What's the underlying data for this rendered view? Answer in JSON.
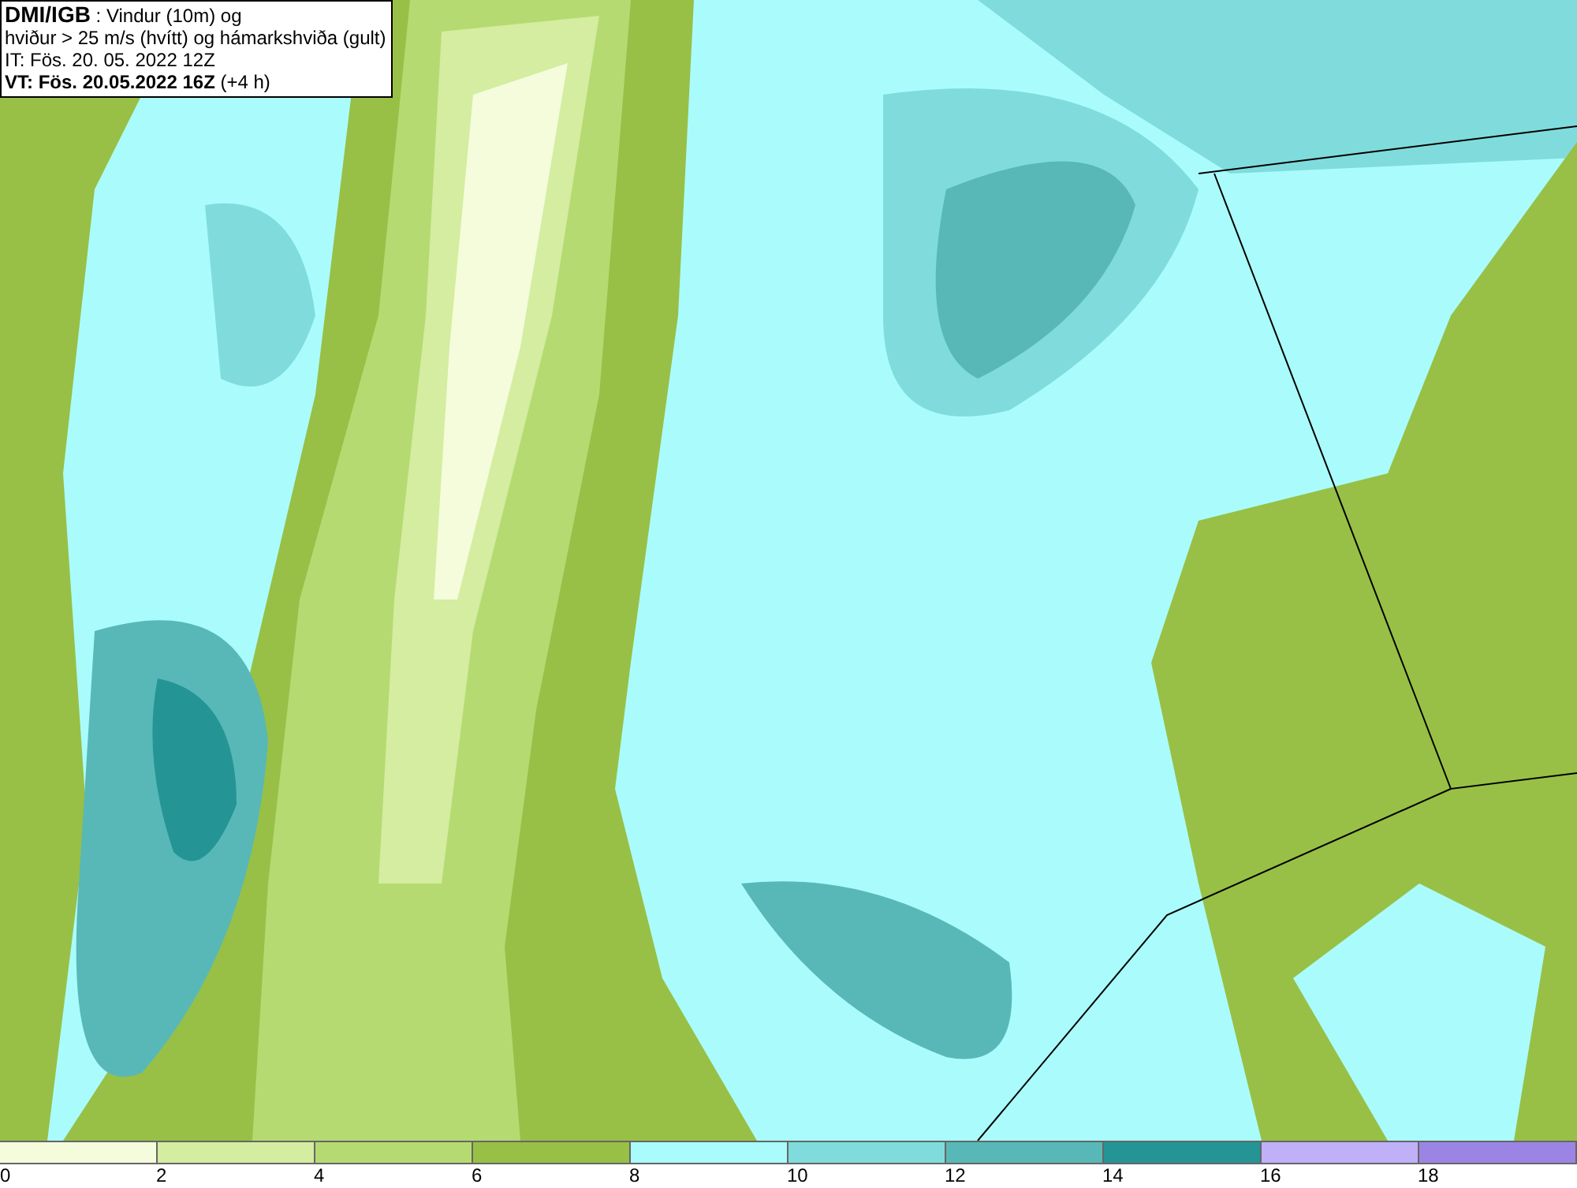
{
  "info_box": {
    "lines": [
      "**DMI/IGB** : Vindur (10m) og",
      "hviður > 25 m/s (hvítt) og hámarkshviða (gult)",
      "IT: Fös. 20. 05. 2022 12Z",
      "**VT: Fös. 20.05.2022 16Z** (+4 h)"
    ]
  },
  "legend": [
    {
      "color": "#f4fcdc",
      "label": "0"
    },
    {
      "color": "#d4eda0",
      "label": "2"
    },
    {
      "color": "#b6da72",
      "label": "4"
    },
    {
      "color": "#98c046",
      "label": "6"
    },
    {
      "color": "#aafcfc",
      "label": "8"
    },
    {
      "color": "#80dcdc",
      "label": "10"
    },
    {
      "color": "#58b8b8",
      "label": "12"
    },
    {
      "color": "#259494",
      "label": "14"
    },
    {
      "color": "#c0b0f8",
      "label": "16"
    },
    {
      "color": "#9c84e4",
      "label": "18"
    }
  ]
}
